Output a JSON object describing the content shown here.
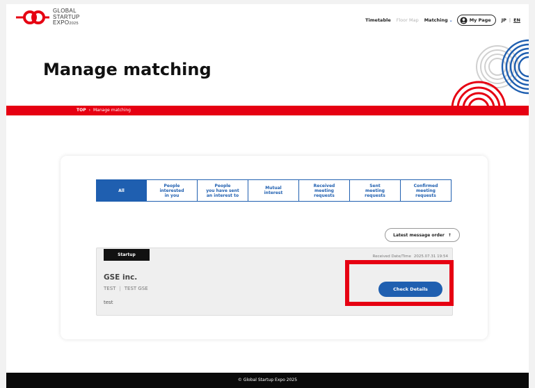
{
  "header": {
    "logo_lines": [
      "GLOBAL",
      "STARTUP",
      "EXPO"
    ],
    "logo_year": "2025",
    "nav": {
      "timetable": "Timetable",
      "floor_map": "Floor Map",
      "matching": "Matching",
      "my_page": "My Page",
      "lang_jp": "JP",
      "lang_en": "EN"
    }
  },
  "page": {
    "title": "Manage matching"
  },
  "breadcrumb": {
    "top": "TOP",
    "current": "Manage matching"
  },
  "tabs": [
    {
      "label": "All",
      "active": true
    },
    {
      "label": "People interested in you",
      "lines": [
        "People",
        "interested",
        "in you"
      ]
    },
    {
      "label": "People you have sent an interest to",
      "lines": [
        "People",
        "you have sent",
        "an interest to"
      ]
    },
    {
      "label": "Mutual interest",
      "lines": [
        "Mutual",
        "interest"
      ]
    },
    {
      "label": "Received meeting requests",
      "lines": [
        "Received",
        "meeting",
        "requests"
      ]
    },
    {
      "label": "Sent meeting requests",
      "lines": [
        "Sent",
        "meeting",
        "requests"
      ]
    },
    {
      "label": "Confirmed meeting requests",
      "lines": [
        "Confirmed",
        "meeting",
        "requests"
      ]
    }
  ],
  "sort": {
    "label": "Latest message order",
    "arrow": "↑"
  },
  "item": {
    "badge": "Startup",
    "received_label": "Received Date/Time",
    "received_date": "2025.07.31 19:54",
    "company": "GSE inc.",
    "person_1": "TEST",
    "person_2": "TEST GSE",
    "note": "test",
    "button": "Check Details"
  },
  "footer": {
    "copyright": "© Global Startup Expo 2025"
  },
  "colors": {
    "brand_red": "#e60012",
    "brand_blue": "#1f5fb0"
  }
}
